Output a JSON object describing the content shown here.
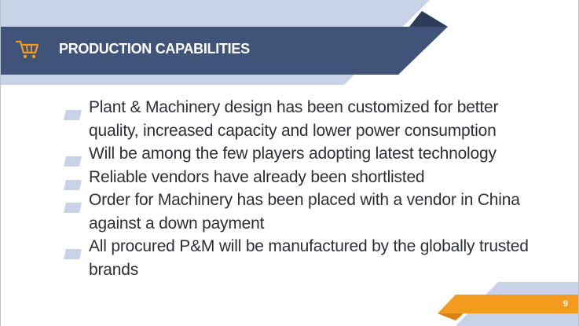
{
  "slide": {
    "title": "PRODUCTION CAPABILITIES",
    "title_icon": "shopping-cart-icon",
    "bullets": [
      "Plant & Machinery design has been customized for better quality, increased capacity and lower power consumption",
      "Will be among the few players adopting latest technology",
      "Reliable vendors have already been shortlisted",
      "Order for Machinery has been placed with a vendor in China against a down payment",
      "All procured P&M will be manufactured by the globally trusted brands"
    ],
    "page_number": "9"
  },
  "colors": {
    "header_band": "#3f5478",
    "light_band": "#c8d3e7",
    "dark_accent": "#2d3c58",
    "accent_orange": "#f39a1f",
    "bullet_marker": "#c8d3e7",
    "body_text": "#2b2f36"
  }
}
